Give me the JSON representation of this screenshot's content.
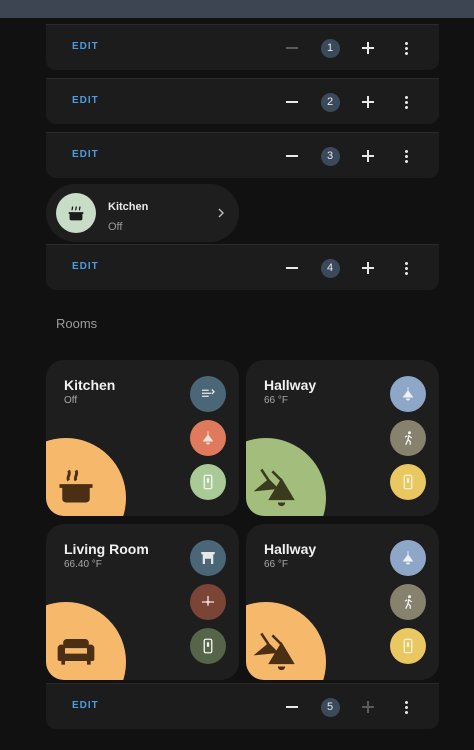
{
  "colors": {
    "background": "#111111",
    "card": "#1e1e1e",
    "edit_link": "#4d9be0",
    "badge": "#3b4a5b"
  },
  "edit_bars": [
    {
      "label": "EDIT",
      "number": "1",
      "minus_disabled": true,
      "plus_disabled": false
    },
    {
      "label": "EDIT",
      "number": "2",
      "minus_disabled": false,
      "plus_disabled": false
    },
    {
      "label": "EDIT",
      "number": "3",
      "minus_disabled": false,
      "plus_disabled": false
    },
    {
      "label": "EDIT",
      "number": "4",
      "minus_disabled": false,
      "plus_disabled": false
    },
    {
      "label": "EDIT",
      "number": "5",
      "minus_disabled": false,
      "plus_disabled": true
    }
  ],
  "chip": {
    "name": "Kitchen",
    "state": "Off",
    "icon": "stove-icon",
    "icon_bg": "#c9dcc8"
  },
  "rooms_section": {
    "title": "Rooms"
  },
  "rooms": [
    {
      "name": "Kitchen",
      "subtitle": "Off",
      "icon": "stove-icon",
      "circle_color": "#f6b96b",
      "buttons": [
        {
          "icon": "fan-heater-icon",
          "color": "#4a6677"
        },
        {
          "icon": "ceiling-light-icon",
          "color": "#df7a5c"
        },
        {
          "icon": "light-switch-icon",
          "color": "#a9c996"
        }
      ]
    },
    {
      "name": "Hallway",
      "subtitle": "66 °F",
      "icon": "ceiling-lights-icon",
      "circle_color": "#a3bd7c",
      "buttons": [
        {
          "icon": "ceiling-light-icon",
          "color": "#8ea6c7"
        },
        {
          "icon": "motion-sensor-icon",
          "color": "#87826e"
        },
        {
          "icon": "light-switch-icon",
          "color": "#e9c761"
        }
      ]
    },
    {
      "name": "Living Room",
      "subtitle": "66.40 °F",
      "icon": "sofa-icon",
      "circle_color": "#f6b96b",
      "buttons": [
        {
          "icon": "fireplace-icon",
          "color": "#4a6677"
        },
        {
          "icon": "ceiling-fan-icon",
          "color": "#7a4537"
        },
        {
          "icon": "light-switch-icon",
          "color": "#56654a"
        }
      ]
    },
    {
      "name": "Hallway",
      "subtitle": "66 °F",
      "icon": "ceiling-lights-icon",
      "circle_color": "#f6b96b",
      "buttons": [
        {
          "icon": "ceiling-light-icon",
          "color": "#8ea6c7"
        },
        {
          "icon": "motion-sensor-icon",
          "color": "#87826e"
        },
        {
          "icon": "light-switch-icon",
          "color": "#e9c761"
        }
      ]
    }
  ]
}
